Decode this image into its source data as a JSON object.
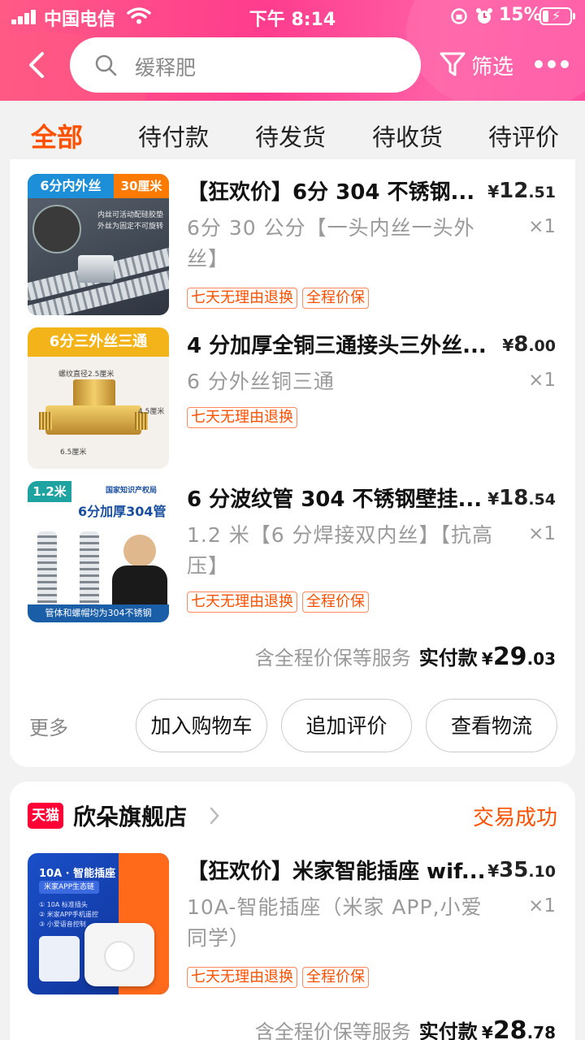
{
  "status_bar": {
    "carrier": "中国电信",
    "time": "下午 8:14",
    "battery": "15%"
  },
  "search": {
    "query": "缓释肥"
  },
  "header": {
    "filter_label": "筛选"
  },
  "tabs": [
    "全部",
    "待付款",
    "待发货",
    "待收货",
    "待评价"
  ],
  "orders": [
    {
      "items": [
        {
          "thumb_texts": [
            "6分内外丝",
            "30厘米",
            "内丝可活动配硅胶垫",
            "外丝为固定不可旋转"
          ],
          "title": "【狂欢价】6分 304 不锈钢...",
          "price_int": "12",
          "price_dec": ".51",
          "spec": "6分 30 公分【一头内丝一头外丝】",
          "qty": "×1",
          "tags": [
            "七天无理由退换",
            "全程价保"
          ]
        },
        {
          "thumb_texts": [
            "6分三外丝三通",
            "螺纹直径2.5厘米",
            "4.5厘米",
            "6.5厘米"
          ],
          "title": "4 分加厚全铜三通接头三外丝...",
          "price_int": "8",
          "price_dec": ".00",
          "spec": "6 分外丝铜三通",
          "qty": "×1",
          "tags": [
            "七天无理由退换"
          ]
        },
        {
          "thumb_texts": [
            "1.2米",
            "国家知识产权局",
            "6分加厚304管",
            "管体和螺帽均为304不锈钢"
          ],
          "title": "6 分波纹管 304 不锈钢壁挂...",
          "price_int": "18",
          "price_dec": ".54",
          "spec": "1.2 米【6 分焊接双内丝】【抗高压】",
          "qty": "×1",
          "tags": [
            "七天无理由退换",
            "全程价保"
          ]
        }
      ],
      "service_text": "含全程价保等服务",
      "paid_label": "实付款",
      "paid_int": "29",
      "paid_dec": ".03",
      "more_label": "更多",
      "buttons": [
        "加入购物车",
        "追加评价",
        "查看物流"
      ]
    },
    {
      "shop_badge": "天猫",
      "shop_name": "欣朵旗舰店",
      "status": "交易成功",
      "items": [
        {
          "thumb_texts": [
            "10A · 智能插座",
            "米家APP生态链",
            "① 10A 标准插头",
            "② 米家APP手机遥控",
            "③ 小爱语音控制"
          ],
          "title": "【狂欢价】米家智能插座 wif...",
          "price_int": "35",
          "price_dec": ".10",
          "spec": "10A-智能插座（米家 APP,小爱同学）",
          "qty": "×1",
          "tags": [
            "七天无理由退换",
            "全程价保"
          ]
        }
      ],
      "service_text": "含全程价保等服务",
      "paid_label": "实付款",
      "paid_int": "28",
      "paid_dec": ".78"
    }
  ],
  "currency_symbol": "¥",
  "colors": {
    "accent": "#ff5000",
    "header": "#ff3c8e",
    "tmall": "#ff0036"
  }
}
